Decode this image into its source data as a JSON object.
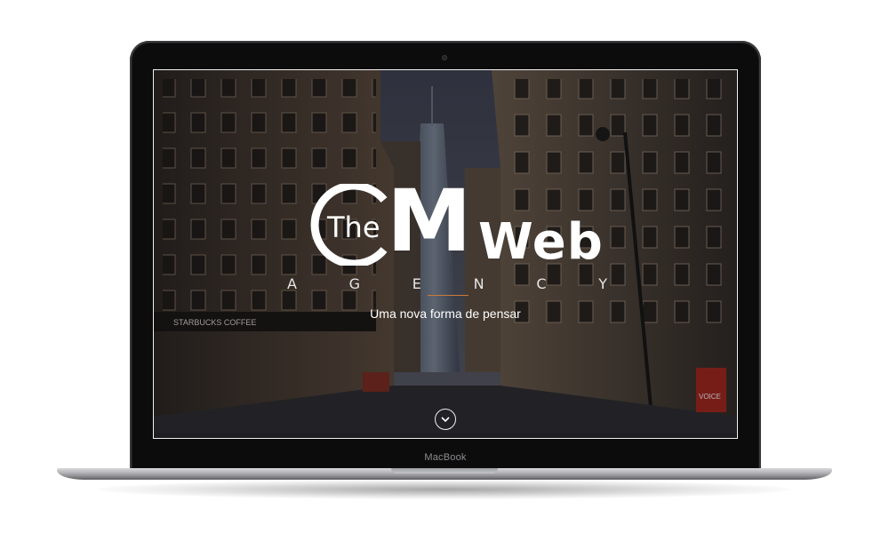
{
  "device": {
    "brand_label": "MacBook"
  },
  "hero": {
    "logo": {
      "the": "The",
      "cm": "CM",
      "web": "Web"
    },
    "agency_letters": [
      "A",
      "G",
      "E",
      "N",
      "C",
      "Y"
    ],
    "tagline": "Uma nova forma de pensar",
    "scroll_icon": "chevron-down-icon"
  },
  "scene_signs": {
    "starbucks": "STARBUCKS COFFEE",
    "voice": "VOICE"
  },
  "colors": {
    "accent_rule": "#c87a3a",
    "text": "#ffffff"
  }
}
